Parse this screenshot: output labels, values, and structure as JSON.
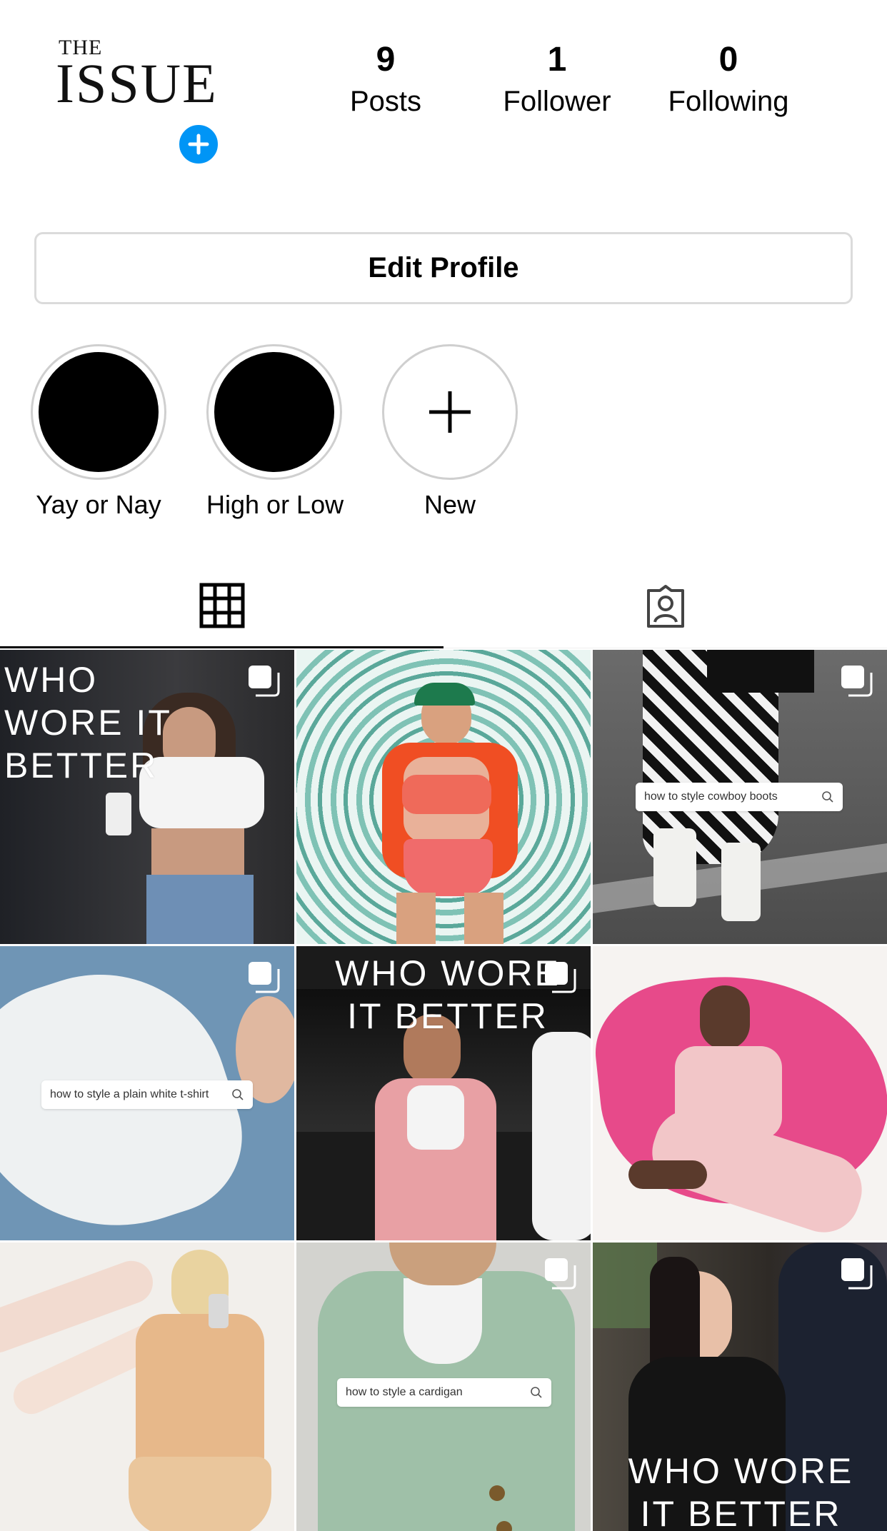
{
  "profile": {
    "logo_top": "THE",
    "logo_main": "ISSUE",
    "stats": [
      {
        "value": "9",
        "label": "Posts"
      },
      {
        "value": "1",
        "label": "Follower"
      },
      {
        "value": "0",
        "label": "Following"
      }
    ],
    "edit_button": "Edit Profile"
  },
  "highlights": [
    {
      "label": "Yay or Nay"
    },
    {
      "label": "High or Low"
    },
    {
      "label": "New"
    }
  ],
  "tabs": [
    {
      "icon": "grid-icon",
      "active": true
    },
    {
      "icon": "tagged-icon",
      "active": false
    }
  ],
  "posts": [
    {
      "overlay": "WHO\nWORE IT\nBETTER",
      "multi": true
    },
    {
      "multi": false
    },
    {
      "search": "how to style cowboy boots",
      "multi": true
    },
    {
      "search": "how to style a plain white t-shirt",
      "multi": true
    },
    {
      "overlay": "WHO WORE\nIT BETTER",
      "multi": true
    },
    {
      "multi": false
    },
    {
      "multi": false
    },
    {
      "search": "how to style a cardigan",
      "multi": true
    },
    {
      "overlay": "WHO WORE\nIT BETTER",
      "multi": true
    }
  ],
  "colors": {
    "accent_blue": "#0095f6",
    "border": "#dbdbdb"
  }
}
